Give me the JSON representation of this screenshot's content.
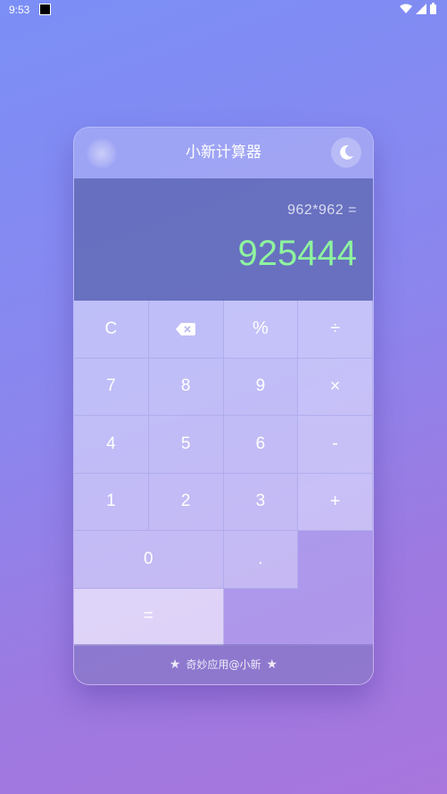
{
  "statusbar": {
    "time": "9:53"
  },
  "app": {
    "title": "小新计算器"
  },
  "display": {
    "expression": "962*962 =",
    "result": "925444"
  },
  "keys": {
    "clear": "C",
    "percent": "%",
    "divide": "÷",
    "seven": "7",
    "eight": "8",
    "nine": "9",
    "multiply": "×",
    "four": "4",
    "five": "5",
    "six": "6",
    "minus": "-",
    "one": "1",
    "two": "2",
    "three": "3",
    "plus": "+",
    "zero": "0",
    "dot": ".",
    "equals": "="
  },
  "footer": {
    "text": "奇妙应用@小新"
  },
  "colors": {
    "result": "#8ef59e",
    "background_top": "#7b8ff6",
    "background_bottom": "#a876dd"
  },
  "icons": [
    "backspace-icon",
    "moon-icon",
    "star-icon",
    "wifi-icon",
    "signal-icon",
    "battery-icon"
  ]
}
